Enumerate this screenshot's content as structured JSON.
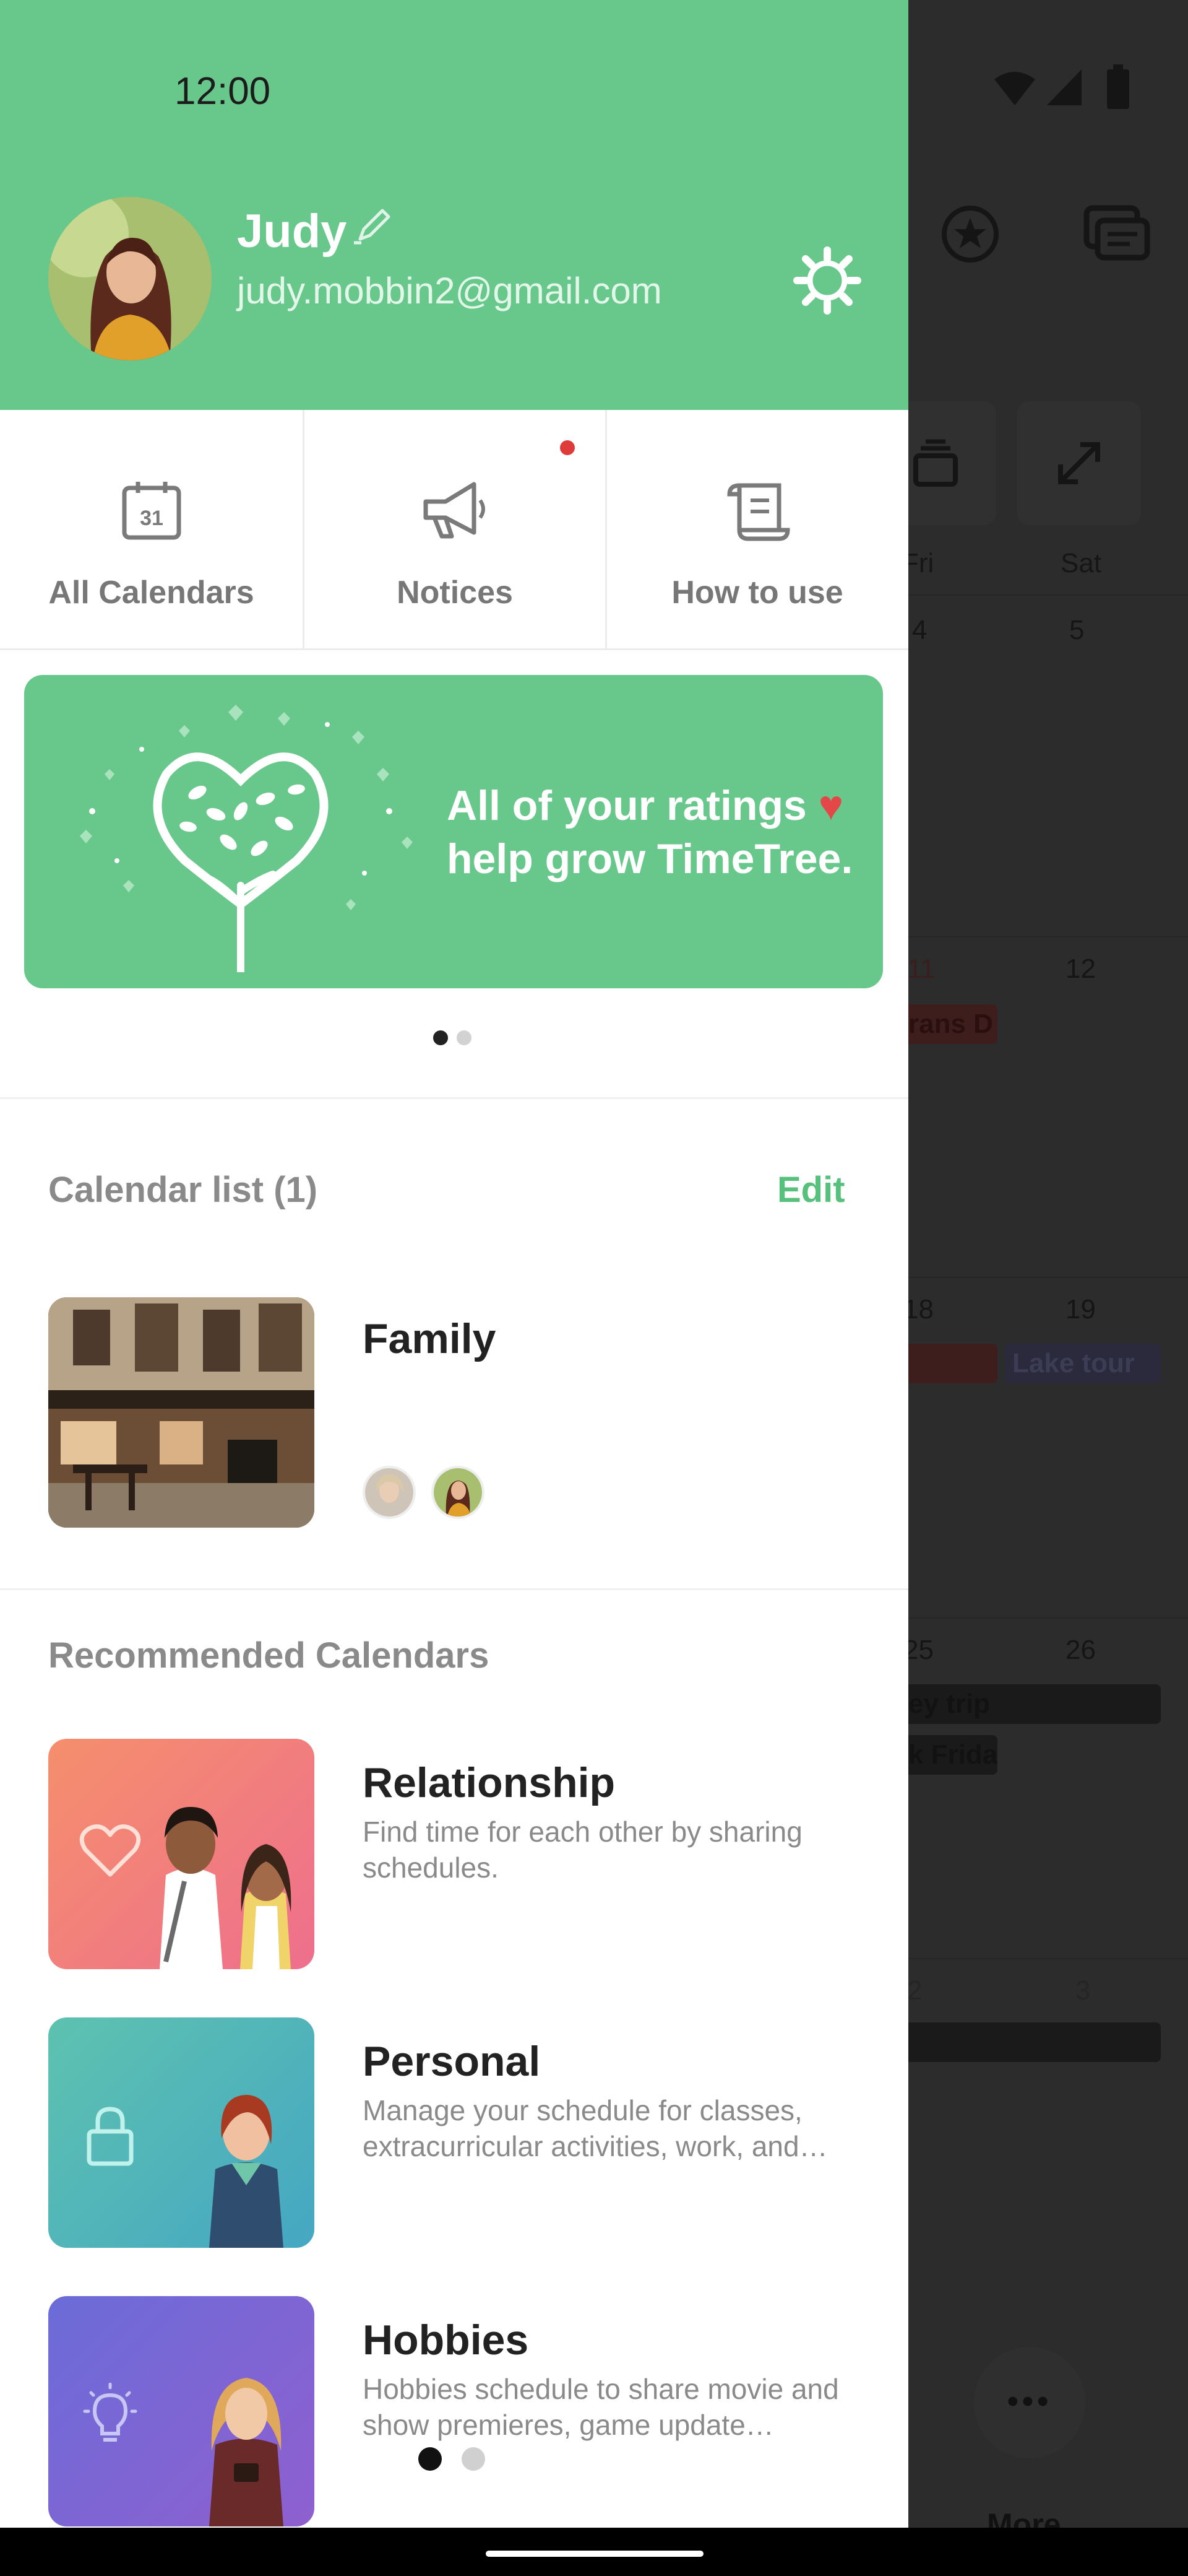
{
  "status_bar": {
    "time": "12:00"
  },
  "profile": {
    "name": "Judy",
    "email": "judy.mobbin2@gmail.com"
  },
  "quick_actions": [
    {
      "label": "All Calendars",
      "icon": "calendar-icon",
      "icon_text": "31"
    },
    {
      "label": "Notices",
      "icon": "megaphone-icon",
      "has_unread": true
    },
    {
      "label": "How to use",
      "icon": "scroll-icon"
    }
  ],
  "banner": {
    "line1": "All of your ratings",
    "heart": "♥",
    "line2": "help grow TimeTree.",
    "page_count": 2,
    "active_index": 0
  },
  "calendar_list": {
    "title": "Calendar list (1)",
    "edit_label": "Edit",
    "items": [
      {
        "name": "Family",
        "members": [
          "member-avatar-1",
          "member-avatar-2"
        ]
      }
    ]
  },
  "recommended": {
    "title": "Recommended Calendars",
    "items": [
      {
        "name": "Relationship",
        "description": "Find time for each other by sharing schedules.",
        "icon": "heart-icon"
      },
      {
        "name": "Personal",
        "description": "Manage your schedule for classes, extracurricular activities, work, and…",
        "icon": "lock-icon"
      },
      {
        "name": "Hobbies",
        "description": "Hobbies schedule to share movie and show premieres, game update…",
        "icon": "lightbulb-icon"
      }
    ]
  },
  "recommended_pager": {
    "page_count": 2,
    "active_index": 0
  },
  "background_calendar": {
    "weekday_labels": [
      "Fri",
      "Sat"
    ],
    "rows": [
      {
        "days": [
          "4",
          "5"
        ]
      },
      {
        "days": [
          "11",
          "12"
        ],
        "events": [
          "rans D"
        ]
      },
      {
        "days": [
          "18",
          "19"
        ],
        "events": [
          "",
          "Lake tour"
        ]
      },
      {
        "days": [
          "25",
          "26"
        ],
        "events": [
          "ey trip",
          "k Frida"
        ]
      },
      {
        "days": [
          "2",
          "3"
        ]
      }
    ],
    "more_label": "More"
  },
  "colors": {
    "brand_green": "#68c88b",
    "link_green": "#56c07c",
    "notice_red": "#e03b3b",
    "overlay_dark": "#2c2c2c"
  }
}
